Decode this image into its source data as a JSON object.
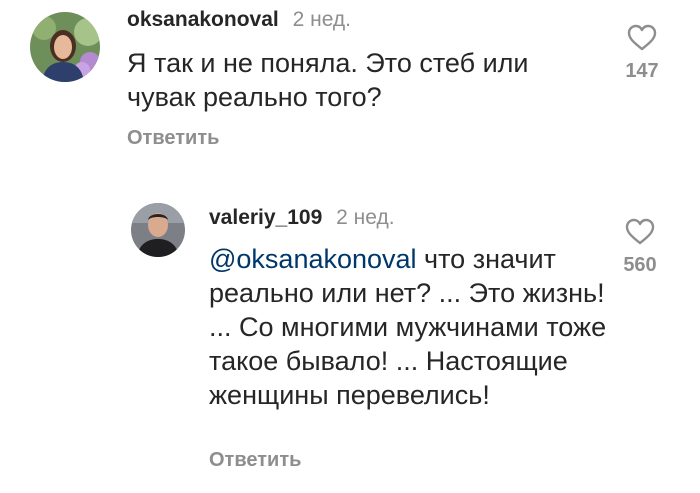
{
  "comments": [
    {
      "username": "oksanakonoval",
      "time": "2 нед.",
      "text": "Я так и не поняла. Это стеб или чувак реально того?",
      "reply_label": "Ответить",
      "likes": "147"
    },
    {
      "username": "valeriy_109",
      "time": "2 нед.",
      "mention": "@oksanakonoval",
      "text": " что значит реально или нет? ... Это жизнь! ... Со многими мужчинами тоже такое бывало! ... Настоящие женщины перевелись!",
      "reply_label": "Ответить",
      "likes": "560"
    }
  ],
  "colors": {
    "text": "#262626",
    "muted": "#8e8e8e",
    "mention": "#00376b",
    "background": "#ffffff"
  },
  "icons": {
    "like": "heart-outline-icon"
  }
}
